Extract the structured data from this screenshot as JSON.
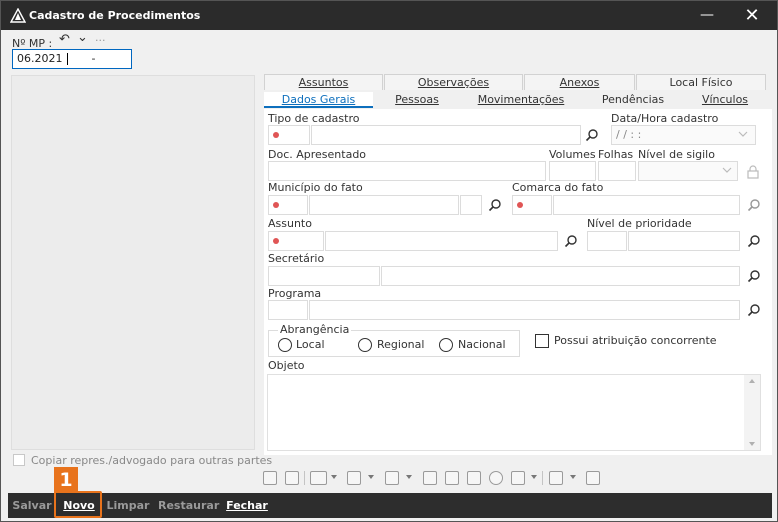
{
  "window": {
    "title": "Cadastro de Procedimentos",
    "min_glyph": "—",
    "close_glyph": "✕"
  },
  "header": {
    "mp_label": "Nº MP :",
    "mp_value": "06.2021",
    "mp_suffix": "-",
    "undo_glyph": "↶",
    "chevron_glyph": "⌄",
    "more_glyph": "···"
  },
  "left": {
    "copy_label": "Copiar repres./advogado para outras partes"
  },
  "tabs": {
    "row1": [
      "Assuntos",
      "Observações",
      "Anexos",
      "Local Físico"
    ],
    "row2": [
      "Dados Gerais",
      "Pessoas",
      "Movimentações",
      "Pendências",
      "Vínculos"
    ],
    "active": "Dados Gerais"
  },
  "form": {
    "tipo_cadastro": "Tipo de cadastro",
    "data_hora_cadastro": "Data/Hora cadastro",
    "data_hora_value": " / /      :  :",
    "doc_apresentado": "Doc. Apresentado",
    "volumes": "Volumes",
    "folhas": "Folhas",
    "nivel_sigilo": "Nível de sigilo",
    "municipio_fato": "Município do fato",
    "comarca_fato": "Comarca do fato",
    "assunto": "Assunto",
    "nivel_prioridade": "Nível de prioridade",
    "secretario": "Secretário",
    "programa": "Programa",
    "abrangencia": "Abrangência",
    "radio_local": "Local",
    "radio_regional": "Regional",
    "radio_nacional": "Nacional",
    "possui_atribuicao": "Possui atribuição concorrente",
    "objeto": "Objeto"
  },
  "bottom": {
    "salvar": "Salvar",
    "novo": "Novo",
    "limpar": "Limpar",
    "restaurar": "Restaurar",
    "fechar": "Fechar",
    "badge": "1"
  },
  "colors": {
    "accent": "#0d6fbd",
    "required": "#e05555",
    "highlight": "#e8731c",
    "titlebar": "#2b2b2b"
  }
}
